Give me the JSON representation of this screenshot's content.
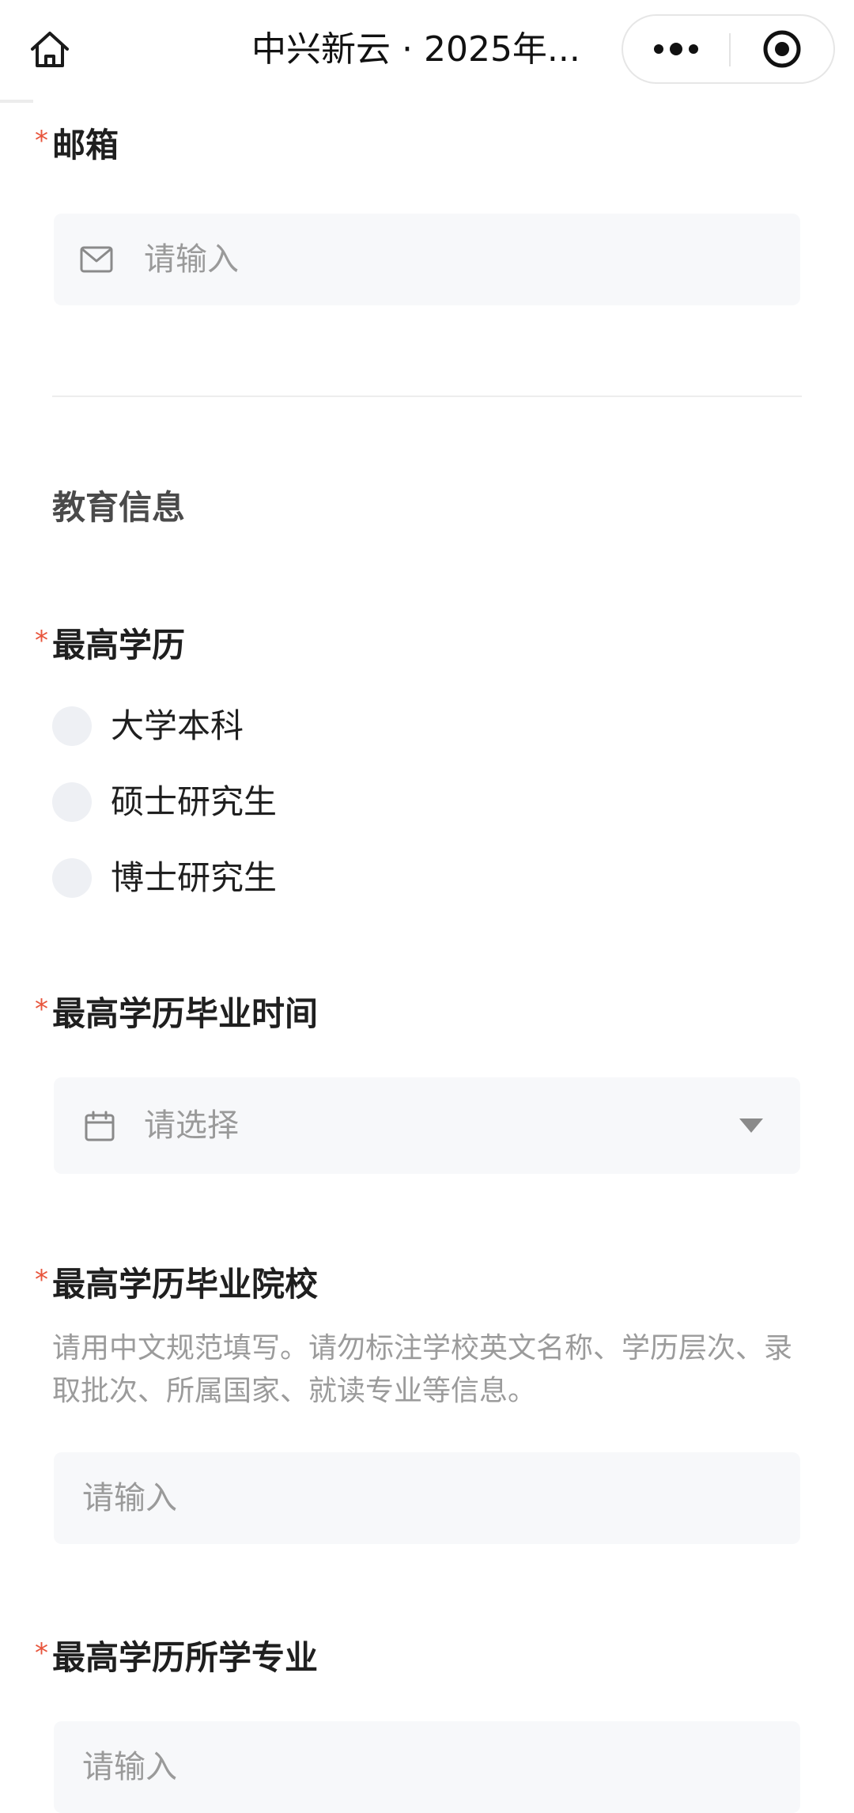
{
  "navbar": {
    "title": "中兴新云 · 2025年...",
    "home_icon": "home-icon",
    "more_icon": "more-dots-icon",
    "close_icon": "target-close-icon"
  },
  "form": {
    "required_mark": "*",
    "email": {
      "label": "邮箱",
      "placeholder": "请输入",
      "icon": "mail-icon"
    },
    "education_section": {
      "title": "教育信息"
    },
    "highest_degree": {
      "label": "最高学历",
      "options": [
        "大学本科",
        "硕士研究生",
        "博士研究生"
      ]
    },
    "graduation_time": {
      "label": "最高学历毕业时间",
      "placeholder": "请选择",
      "icon": "calendar-icon",
      "dropdown_icon": "caret-down-icon"
    },
    "graduation_school": {
      "label": "最高学历毕业院校",
      "hint": "请用中文规范填写。请勿标注学校英文名称、学历层次、录取批次、所属国家、就读专业等信息。",
      "placeholder": "请输入"
    },
    "major": {
      "label": "最高学历所学专业",
      "placeholder": "请输入"
    }
  },
  "colors": {
    "required": "#e8553c",
    "field_bg": "#f7f8fa",
    "placeholder": "#9a9a9a",
    "radio_bg": "#eef0f4"
  }
}
